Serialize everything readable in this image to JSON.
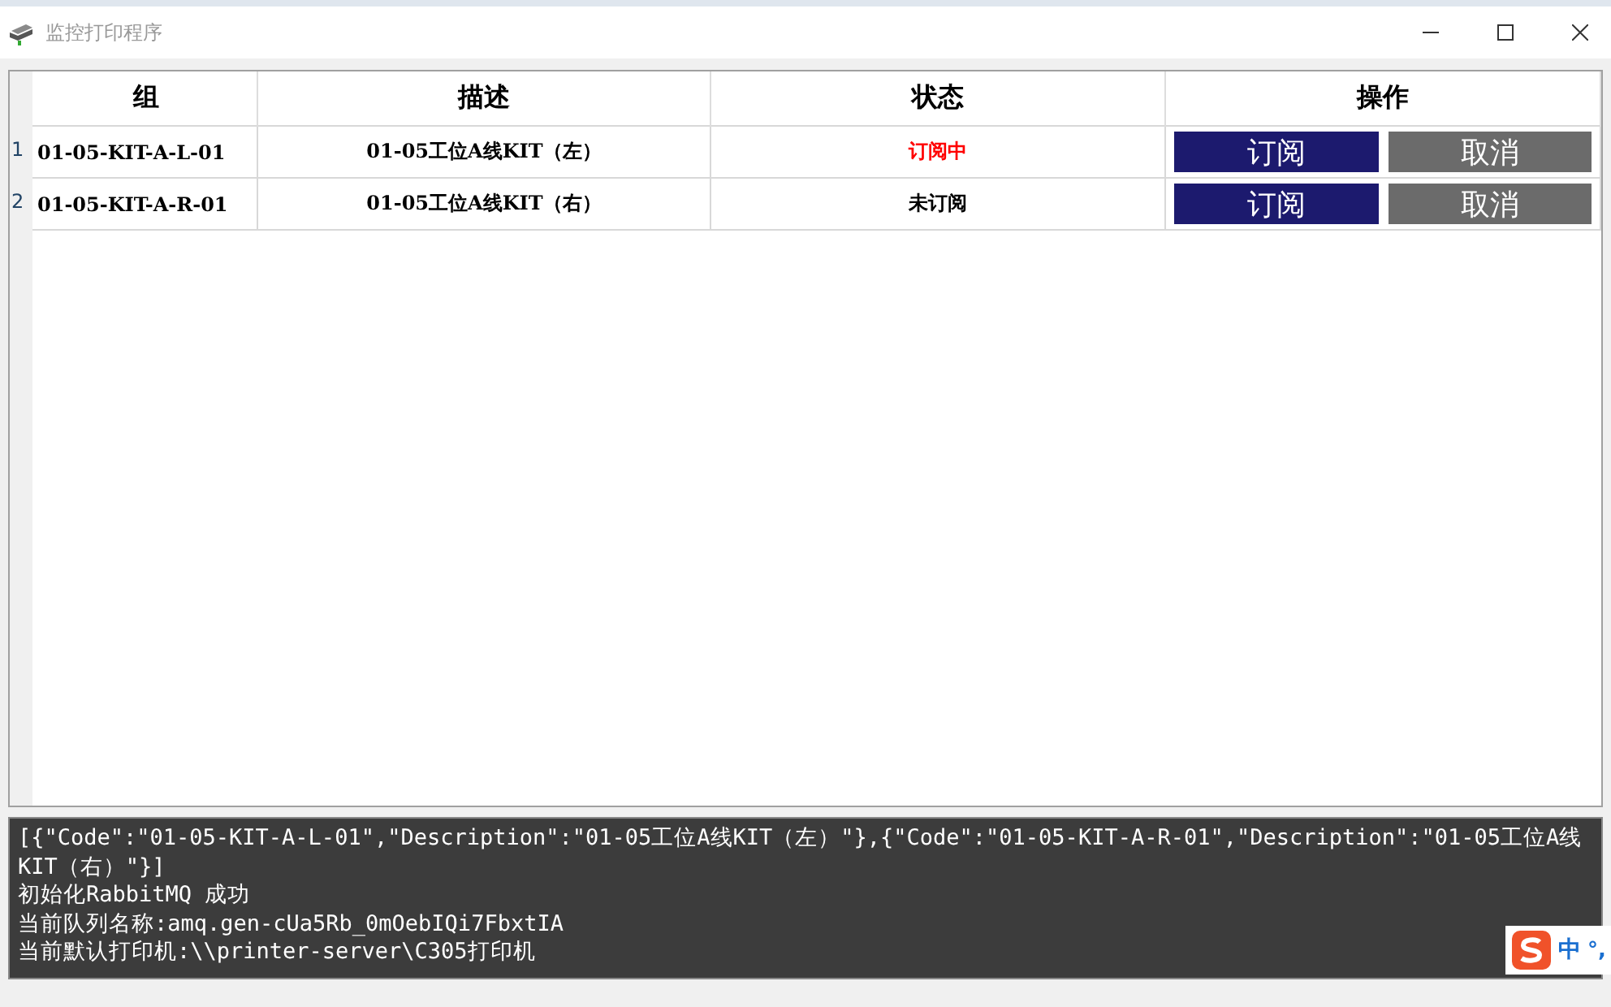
{
  "window": {
    "title": "监控打印程序"
  },
  "table": {
    "columns": [
      "组",
      "描述",
      "状态",
      "操作"
    ],
    "rows": [
      {
        "index": "1",
        "group": "01-05-KIT-A-L-01",
        "description": "01-05工位A线KIT（左）",
        "status": "订阅中",
        "subscribed": true,
        "subscribe_button": "订阅",
        "cancel_button": "取消"
      },
      {
        "index": "2",
        "group": "01-05-KIT-A-R-01",
        "description": "01-05工位A线KIT（右）",
        "status": "未订阅",
        "subscribed": false,
        "subscribe_button": "订阅",
        "cancel_button": "取消"
      }
    ]
  },
  "log": {
    "lines": [
      "[{\"Code\":\"01-05-KIT-A-L-01\",\"Description\":\"01-05工位A线KIT（左）\"},{\"Code\":\"01-05-KIT-A-R-01\",\"Description\":\"01-05工位A线KIT（右）\"}]",
      "初始化RabbitMQ 成功",
      "当前队列名称:amq.gen-cUa5Rb_0mOebIQi7FbxtIA",
      "当前默认打印机:\\\\printer-server\\C305打印机"
    ]
  },
  "ime": {
    "mode": "中",
    "punct": "°,"
  }
}
